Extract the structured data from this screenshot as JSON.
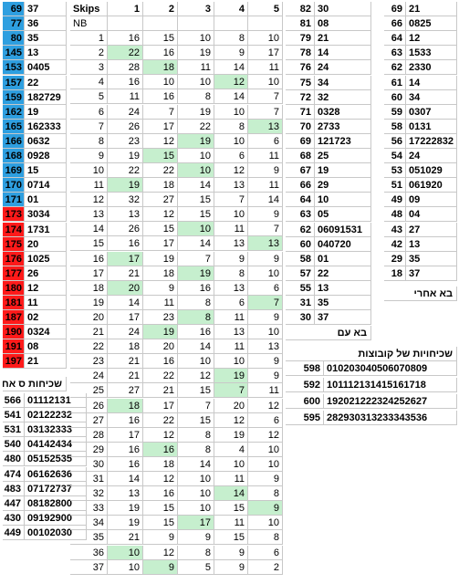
{
  "colors": {
    "blue": "#2e9fe0",
    "red": "#ff1a1a",
    "green": "#c6efce"
  },
  "left_pairs": [
    [
      "69",
      "37",
      "blue"
    ],
    [
      "77",
      "36",
      "blue"
    ],
    [
      "80",
      "35",
      "blue"
    ],
    [
      "145",
      "13",
      "blue"
    ],
    [
      "153",
      "0405",
      "blue"
    ],
    [
      "157",
      "22",
      "blue"
    ],
    [
      "159",
      "182729",
      "blue"
    ],
    [
      "162",
      "19",
      "blue"
    ],
    [
      "165",
      "162333",
      "blue"
    ],
    [
      "166",
      "0632",
      "blue"
    ],
    [
      "168",
      "0928",
      "blue"
    ],
    [
      "169",
      "15",
      "blue"
    ],
    [
      "170",
      "0714",
      "blue"
    ],
    [
      "171",
      "01",
      "blue"
    ],
    [
      "173",
      "3034",
      "red"
    ],
    [
      "174",
      "1731",
      "red"
    ],
    [
      "175",
      "20",
      "red"
    ],
    [
      "176",
      "1025",
      "red"
    ],
    [
      "177",
      "26",
      "red"
    ],
    [
      "180",
      "12",
      "red"
    ],
    [
      "181",
      "11",
      "red"
    ],
    [
      "187",
      "02",
      "red"
    ],
    [
      "190",
      "0324",
      "red"
    ],
    [
      "191",
      "08",
      "red"
    ],
    [
      "197",
      "21",
      "red"
    ]
  ],
  "single_header": "שכיחות ס אחדות",
  "single_freq": [
    [
      "566",
      "01112131"
    ],
    [
      "541",
      "02122232"
    ],
    [
      "531",
      "03132333"
    ],
    [
      "540",
      "04142434"
    ],
    [
      "480",
      "05152535"
    ],
    [
      "474",
      "06162636"
    ],
    [
      "483",
      "07172737"
    ],
    [
      "447",
      "08182800"
    ],
    [
      "430",
      "09192900"
    ],
    [
      "449",
      "00102030"
    ]
  ],
  "skips": {
    "title": "Skips",
    "nb_label": "NB",
    "cols": [
      "1",
      "2",
      "3",
      "4",
      "5"
    ],
    "rows": [
      [
        "1",
        "16",
        "15",
        "10",
        "8",
        "10"
      ],
      [
        "2",
        "22",
        "16",
        "19",
        "9",
        "17"
      ],
      [
        "3",
        "28",
        "18",
        "11",
        "14",
        "11"
      ],
      [
        "4",
        "16",
        "10",
        "10",
        "12",
        "10"
      ],
      [
        "5",
        "11",
        "16",
        "8",
        "14",
        "7"
      ],
      [
        "6",
        "24",
        "7",
        "19",
        "10",
        "7"
      ],
      [
        "7",
        "26",
        "17",
        "22",
        "8",
        "13"
      ],
      [
        "8",
        "23",
        "12",
        "19",
        "10",
        "6"
      ],
      [
        "9",
        "19",
        "15",
        "10",
        "6",
        "11"
      ],
      [
        "10",
        "22",
        "22",
        "10",
        "12",
        "9"
      ],
      [
        "11",
        "19",
        "18",
        "14",
        "13",
        "11"
      ],
      [
        "12",
        "32",
        "27",
        "15",
        "7",
        "14"
      ],
      [
        "13",
        "13",
        "12",
        "15",
        "10",
        "9"
      ],
      [
        "14",
        "26",
        "15",
        "10",
        "11",
        "7"
      ],
      [
        "15",
        "16",
        "17",
        "14",
        "13",
        "13"
      ],
      [
        "16",
        "17",
        "19",
        "7",
        "9",
        "9"
      ],
      [
        "17",
        "21",
        "18",
        "19",
        "8",
        "10"
      ],
      [
        "18",
        "20",
        "9",
        "16",
        "13",
        "6"
      ],
      [
        "19",
        "14",
        "11",
        "8",
        "6",
        "7"
      ],
      [
        "20",
        "17",
        "23",
        "8",
        "11",
        "9"
      ],
      [
        "21",
        "24",
        "19",
        "16",
        "13",
        "10"
      ],
      [
        "22",
        "18",
        "20",
        "14",
        "11",
        "13"
      ],
      [
        "23",
        "21",
        "16",
        "10",
        "10",
        "9"
      ],
      [
        "24",
        "21",
        "22",
        "12",
        "19",
        "9"
      ],
      [
        "25",
        "27",
        "21",
        "15",
        "7",
        "11"
      ],
      [
        "26",
        "18",
        "17",
        "7",
        "20",
        "12"
      ],
      [
        "27",
        "16",
        "22",
        "15",
        "12",
        "6"
      ],
      [
        "28",
        "17",
        "12",
        "8",
        "19",
        "12"
      ],
      [
        "29",
        "16",
        "16",
        "8",
        "4",
        "10"
      ],
      [
        "30",
        "16",
        "18",
        "14",
        "10",
        "10"
      ],
      [
        "31",
        "14",
        "12",
        "10",
        "11",
        "9"
      ],
      [
        "32",
        "13",
        "16",
        "10",
        "14",
        "8"
      ],
      [
        "33",
        "19",
        "15",
        "10",
        "15",
        "9"
      ],
      [
        "34",
        "19",
        "15",
        "17",
        "11",
        "10"
      ],
      [
        "35",
        "21",
        "9",
        "9",
        "15",
        "8"
      ],
      [
        "36",
        "10",
        "12",
        "8",
        "9",
        "6"
      ],
      [
        "37",
        "10",
        "9",
        "5",
        "9",
        "2"
      ]
    ],
    "highlights": [
      [
        2,
        1
      ],
      [
        3,
        2
      ],
      [
        4,
        4
      ],
      [
        7,
        5
      ],
      [
        8,
        3
      ],
      [
        9,
        2
      ],
      [
        10,
        3
      ],
      [
        11,
        1
      ],
      [
        14,
        3
      ],
      [
        15,
        5
      ],
      [
        16,
        1
      ],
      [
        17,
        3
      ],
      [
        18,
        1
      ],
      [
        19,
        5
      ],
      [
        20,
        3
      ],
      [
        21,
        2
      ],
      [
        24,
        4
      ],
      [
        25,
        4
      ],
      [
        26,
        1
      ],
      [
        29,
        2
      ],
      [
        32,
        4
      ],
      [
        33,
        5
      ],
      [
        34,
        3
      ],
      [
        36,
        1
      ],
      [
        37,
        2
      ]
    ]
  },
  "together_pairs": [
    [
      "82",
      "30"
    ],
    [
      "81",
      "08"
    ],
    [
      "79",
      "21"
    ],
    [
      "78",
      "14"
    ],
    [
      "76",
      "24"
    ],
    [
      "75",
      "34"
    ],
    [
      "72",
      "32"
    ],
    [
      "71",
      "0328"
    ],
    [
      "70",
      "2733"
    ],
    [
      "69",
      "121723"
    ],
    [
      "68",
      "25"
    ],
    [
      "67",
      "19"
    ],
    [
      "66",
      "29"
    ],
    [
      "64",
      "10"
    ],
    [
      "63",
      "05"
    ],
    [
      "62",
      "06091531"
    ],
    [
      "60",
      "040720"
    ],
    [
      "58",
      "01"
    ],
    [
      "57",
      "22"
    ],
    [
      "55",
      "13"
    ],
    [
      "31",
      "35"
    ],
    [
      "30",
      "37"
    ]
  ],
  "together_header": "בא עם",
  "after_pairs": [
    [
      "69",
      "21"
    ],
    [
      "66",
      "0825"
    ],
    [
      "64",
      "12"
    ],
    [
      "63",
      "1533"
    ],
    [
      "62",
      "2330"
    ],
    [
      "61",
      "14"
    ],
    [
      "60",
      "34"
    ],
    [
      "59",
      "0307"
    ],
    [
      "58",
      "0131"
    ],
    [
      "56",
      "17222832"
    ],
    [
      "54",
      "24"
    ],
    [
      "53",
      "051029"
    ],
    [
      "51",
      "061920"
    ],
    [
      "49",
      "09"
    ],
    [
      "48",
      "04"
    ],
    [
      "43",
      "27"
    ],
    [
      "42",
      "13"
    ],
    [
      "29",
      "35"
    ],
    [
      "18",
      "37"
    ]
  ],
  "after_header": "בא אחרי",
  "group_header": "שכיחויות של קובוצות",
  "group_freq": [
    [
      "598",
      "010203040506070809"
    ],
    [
      "592",
      "101112131415161718"
    ],
    [
      "600",
      "192021222324252627"
    ],
    [
      "595",
      "282930313233343536"
    ]
  ]
}
